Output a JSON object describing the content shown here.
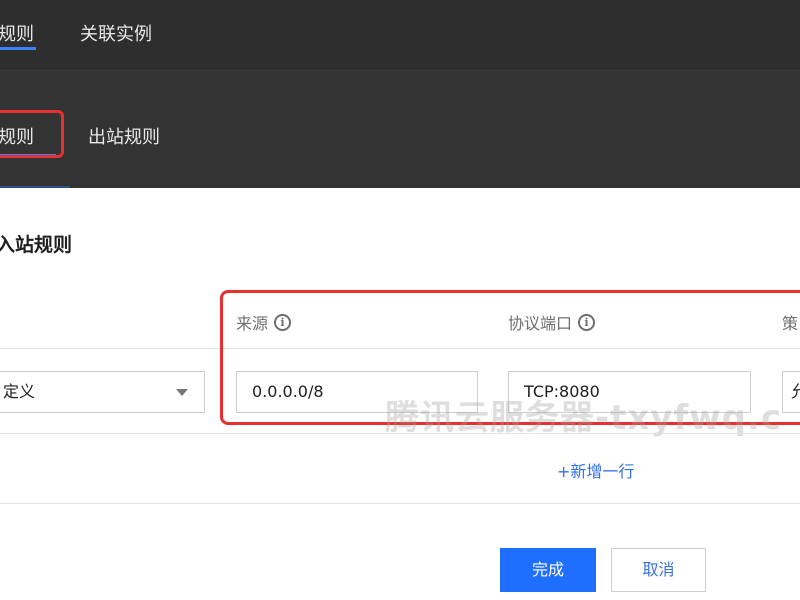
{
  "top_tabs": [
    {
      "label": "规则"
    },
    {
      "label": "关联实例"
    }
  ],
  "sub_tabs": [
    {
      "label": "规则"
    },
    {
      "label": "出站规则"
    }
  ],
  "dialog": {
    "title": "入站规则",
    "columns": {
      "source_label": "来源",
      "port_label": "协议端口",
      "policy_label": "策"
    },
    "row": {
      "type_value": "定义",
      "source_value": "0.0.0.0/8",
      "port_value": "TCP:8080",
      "policy_value": "允"
    },
    "add_row_label": "+新增一行",
    "confirm_label": "完成",
    "cancel_label": "取消"
  },
  "watermark_text": "腾讯云服务器-txyfwq.c",
  "colors": {
    "accent": "#1f6fff",
    "highlight": "#e8302e",
    "link": "#2f6fea"
  }
}
